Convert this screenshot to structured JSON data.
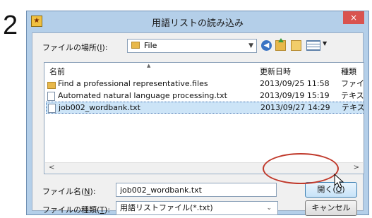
{
  "step_number": "2",
  "dialog": {
    "title": "用語リストの読み込み",
    "close_glyph": "×",
    "location_label": "ファイルの場所(",
    "location_hotkey": "I",
    "location_label_end": "):",
    "location_value": "File",
    "columns": {
      "name": "名前",
      "date": "更新日時",
      "type": "種類"
    },
    "files": [
      {
        "name": "Find a professional representative.files",
        "date": "2013/09/25 11:58",
        "type": "ファイ",
        "icon": "folder-icon",
        "selected": false
      },
      {
        "name": "Automated natural language processing.txt",
        "date": "2013/09/19 15:19",
        "type": "テキス",
        "icon": "text-file-icon",
        "selected": false
      },
      {
        "name": "job002_wordbank.txt",
        "date": "2013/09/27 14:29",
        "type": "テキス",
        "icon": "text-file-icon",
        "selected": true
      }
    ],
    "filename_label": "ファイル名(",
    "filename_hotkey": "N",
    "filename_label_end": "):",
    "filename_value": "job002_wordbank.txt",
    "filetype_label": "ファイルの種類(",
    "filetype_hotkey": "T",
    "filetype_label_end": "):",
    "filetype_value": "用語リストファイル(*.txt)",
    "open_button": "開く(",
    "open_hotkey": "O",
    "open_button_end": ")",
    "cancel_button": "キャンセル",
    "scroll_left": "<",
    "scroll_right": ">"
  },
  "colors": {
    "highlight_ellipse": "#c0392b",
    "selected_row": "#cce4f7",
    "close_button": "#d9534f"
  }
}
